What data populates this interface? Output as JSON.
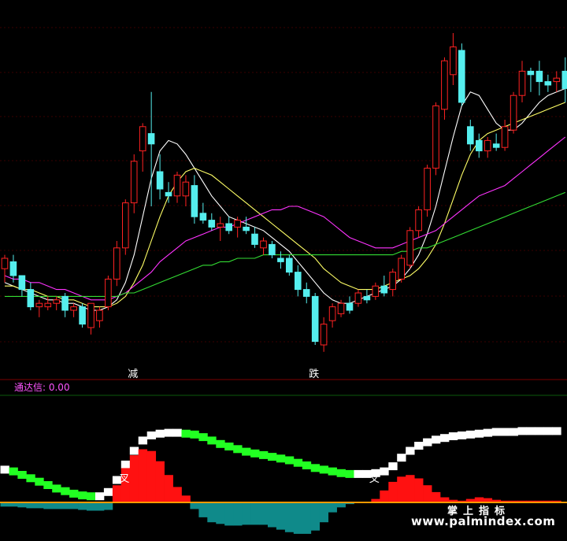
{
  "chart_data": [
    {
      "type": "candlestick",
      "title": "",
      "price_range": [
        0,
        100
      ],
      "candles": [
        {
          "o": 52,
          "h": 56,
          "l": 48,
          "c": 55
        },
        {
          "o": 54,
          "h": 56,
          "l": 48,
          "c": 50
        },
        {
          "o": 50,
          "h": 50,
          "l": 44,
          "c": 46
        },
        {
          "o": 46,
          "h": 48,
          "l": 40,
          "c": 41
        },
        {
          "o": 41,
          "h": 43,
          "l": 38,
          "c": 42
        },
        {
          "o": 41,
          "h": 44,
          "l": 40,
          "c": 42
        },
        {
          "o": 42,
          "h": 44,
          "l": 40,
          "c": 43
        },
        {
          "o": 44,
          "h": 45,
          "l": 38,
          "c": 40
        },
        {
          "o": 40,
          "h": 42,
          "l": 38,
          "c": 41
        },
        {
          "o": 41,
          "h": 42,
          "l": 35,
          "c": 36
        },
        {
          "o": 35,
          "h": 42,
          "l": 33,
          "c": 42
        },
        {
          "o": 37,
          "h": 41,
          "l": 35,
          "c": 40
        },
        {
          "o": 41,
          "h": 50,
          "l": 40,
          "c": 49
        },
        {
          "o": 49,
          "h": 60,
          "l": 47,
          "c": 58
        },
        {
          "o": 58,
          "h": 72,
          "l": 56,
          "c": 71
        },
        {
          "o": 71,
          "h": 85,
          "l": 68,
          "c": 83
        },
        {
          "o": 86,
          "h": 94,
          "l": 80,
          "c": 93
        },
        {
          "o": 91,
          "h": 103,
          "l": 70,
          "c": 88
        },
        {
          "o": 80,
          "h": 85,
          "l": 72,
          "c": 75
        },
        {
          "o": 74,
          "h": 77,
          "l": 71,
          "c": 73
        },
        {
          "o": 73,
          "h": 80,
          "l": 71,
          "c": 79
        },
        {
          "o": 73,
          "h": 79,
          "l": 70,
          "c": 77
        },
        {
          "o": 76,
          "h": 79,
          "l": 65,
          "c": 67
        },
        {
          "o": 68,
          "h": 71,
          "l": 65,
          "c": 66
        },
        {
          "o": 66,
          "h": 68,
          "l": 63,
          "c": 64
        },
        {
          "o": 64,
          "h": 67,
          "l": 60,
          "c": 65
        },
        {
          "o": 65,
          "h": 67,
          "l": 62,
          "c": 63
        },
        {
          "o": 64,
          "h": 67,
          "l": 61,
          "c": 66
        },
        {
          "o": 64,
          "h": 67,
          "l": 62,
          "c": 63
        },
        {
          "o": 62,
          "h": 64,
          "l": 58,
          "c": 59
        },
        {
          "o": 58,
          "h": 61,
          "l": 56,
          "c": 60
        },
        {
          "o": 59,
          "h": 60,
          "l": 55,
          "c": 56
        },
        {
          "o": 55,
          "h": 57,
          "l": 52,
          "c": 54
        },
        {
          "o": 55,
          "h": 56,
          "l": 50,
          "c": 51
        },
        {
          "o": 51,
          "h": 53,
          "l": 44,
          "c": 46
        },
        {
          "o": 46,
          "h": 48,
          "l": 42,
          "c": 44
        },
        {
          "o": 44,
          "h": 45,
          "l": 30,
          "c": 31
        },
        {
          "o": 30,
          "h": 38,
          "l": 28,
          "c": 36
        },
        {
          "o": 37,
          "h": 42,
          "l": 35,
          "c": 41
        },
        {
          "o": 39,
          "h": 43,
          "l": 38,
          "c": 42
        },
        {
          "o": 42,
          "h": 44,
          "l": 39,
          "c": 40
        },
        {
          "o": 42,
          "h": 46,
          "l": 41,
          "c": 45
        },
        {
          "o": 44,
          "h": 46,
          "l": 42,
          "c": 43
        },
        {
          "o": 44,
          "h": 48,
          "l": 43,
          "c": 47
        },
        {
          "o": 47,
          "h": 50,
          "l": 44,
          "c": 45
        },
        {
          "o": 46,
          "h": 52,
          "l": 44,
          "c": 51
        },
        {
          "o": 49,
          "h": 56,
          "l": 48,
          "c": 55
        },
        {
          "o": 53,
          "h": 64,
          "l": 52,
          "c": 63
        },
        {
          "o": 63,
          "h": 70,
          "l": 61,
          "c": 69
        },
        {
          "o": 69,
          "h": 82,
          "l": 67,
          "c": 81
        },
        {
          "o": 81,
          "h": 100,
          "l": 79,
          "c": 99
        },
        {
          "o": 98,
          "h": 113,
          "l": 95,
          "c": 112
        },
        {
          "o": 108,
          "h": 120,
          "l": 105,
          "c": 116
        },
        {
          "o": 115,
          "h": 117,
          "l": 99,
          "c": 100
        },
        {
          "o": 93,
          "h": 95,
          "l": 86,
          "c": 88
        },
        {
          "o": 89,
          "h": 91,
          "l": 84,
          "c": 86
        },
        {
          "o": 86,
          "h": 90,
          "l": 84,
          "c": 89
        },
        {
          "o": 88,
          "h": 91,
          "l": 86,
          "c": 87
        },
        {
          "o": 87,
          "h": 95,
          "l": 86,
          "c": 93
        },
        {
          "o": 92,
          "h": 103,
          "l": 91,
          "c": 102
        },
        {
          "o": 102,
          "h": 112,
          "l": 100,
          "c": 109
        },
        {
          "o": 109,
          "h": 110,
          "l": 103,
          "c": 108
        },
        {
          "o": 109,
          "h": 112,
          "l": 102,
          "c": 106
        },
        {
          "o": 106,
          "h": 108,
          "l": 103,
          "c": 105
        },
        {
          "o": 106,
          "h": 109,
          "l": 103,
          "c": 107
        },
        {
          "o": 109,
          "h": 113,
          "l": 100,
          "c": 104
        }
      ],
      "moving_averages": [
        {
          "label": "MA-white",
          "color": "#ffffff",
          "values": [
            48,
            47,
            46,
            45,
            44,
            43,
            43,
            42,
            42,
            41,
            40,
            40,
            41,
            43,
            48,
            56,
            67,
            78,
            86,
            89,
            88,
            85,
            81,
            77,
            73,
            70,
            67,
            66,
            65,
            64,
            63,
            61,
            59,
            57,
            54,
            51,
            48,
            45,
            43,
            42,
            42,
            43,
            44,
            45,
            46,
            47,
            49,
            52,
            56,
            62,
            70,
            80,
            90,
            99,
            103,
            102,
            98,
            94,
            92,
            92,
            94,
            97,
            100,
            102,
            103,
            104
          ]
        },
        {
          "label": "MA-yellow",
          "color": "#ffff66",
          "values": [
            47,
            47,
            46,
            46,
            45,
            44,
            44,
            43,
            43,
            42,
            41,
            41,
            41,
            42,
            44,
            48,
            53,
            60,
            67,
            73,
            77,
            80,
            81,
            80,
            79,
            77,
            75,
            73,
            71,
            69,
            67,
            65,
            63,
            61,
            59,
            57,
            55,
            52,
            50,
            48,
            47,
            46,
            46,
            46,
            47,
            48,
            49,
            50,
            52,
            55,
            59,
            65,
            72,
            79,
            85,
            89,
            91,
            92,
            93,
            94,
            95,
            96,
            97,
            98,
            99,
            100
          ]
        },
        {
          "label": "MA-magenta",
          "color": "#ff33ff",
          "values": [
            50,
            49,
            49,
            48,
            48,
            47,
            46,
            46,
            45,
            44,
            43,
            43,
            43,
            44,
            45,
            47,
            49,
            51,
            54,
            56,
            58,
            60,
            61,
            62,
            63,
            64,
            64,
            65,
            66,
            67,
            68,
            69,
            69,
            70,
            70,
            69,
            68,
            67,
            65,
            63,
            61,
            60,
            59,
            58,
            58,
            58,
            59,
            60,
            61,
            62,
            63,
            65,
            67,
            69,
            71,
            73,
            74,
            75,
            76,
            78,
            80,
            82,
            84,
            86,
            88,
            90
          ]
        },
        {
          "label": "MA-green",
          "color": "#33dd33",
          "values": [
            44,
            44,
            44,
            44,
            44,
            44,
            44,
            44,
            44,
            44,
            44,
            44,
            44,
            44,
            45,
            45,
            46,
            47,
            48,
            49,
            50,
            51,
            52,
            53,
            53,
            54,
            54,
            55,
            55,
            55,
            56,
            56,
            56,
            56,
            56,
            56,
            56,
            56,
            56,
            56,
            56,
            56,
            56,
            56,
            56,
            56,
            57,
            57,
            58,
            58,
            59,
            60,
            61,
            62,
            63,
            64,
            65,
            66,
            67,
            68,
            69,
            70,
            71,
            72,
            73,
            74
          ]
        }
      ],
      "signals": [
        {
          "index": 14,
          "label": "减",
          "color": "#ffffff"
        },
        {
          "index": 35,
          "label": "跌",
          "color": "#ffffff"
        }
      ]
    },
    {
      "type": "bar",
      "title": "",
      "indicator_name": "通达信",
      "indicator_value": "0.00",
      "readout": "通达信: 0.00",
      "values": [
        -5,
        -5,
        -6,
        -7,
        -7,
        -8,
        -8,
        -8,
        -8,
        -9,
        -10,
        -10,
        -9,
        20,
        40,
        55,
        62,
        60,
        48,
        32,
        18,
        8,
        -8,
        -18,
        -24,
        -26,
        -28,
        -28,
        -27,
        -27,
        -27,
        -30,
        -33,
        -36,
        -38,
        -38,
        -34,
        -24,
        -12,
        -6,
        -2,
        -1,
        0,
        4,
        14,
        24,
        30,
        32,
        28,
        20,
        12,
        6,
        3,
        2,
        4,
        6,
        5,
        3,
        2,
        2,
        2,
        2,
        2,
        2,
        2
      ],
      "band_values": [
        40,
        38,
        34,
        30,
        26,
        22,
        18,
        15,
        12,
        10,
        9,
        9,
        14,
        28,
        46,
        62,
        74,
        80,
        82,
        83,
        83,
        82,
        81,
        78,
        74,
        70,
        67,
        64,
        61,
        59,
        57,
        55,
        53,
        51,
        48,
        45,
        42,
        40,
        38,
        36,
        35,
        35,
        35,
        36,
        38,
        44,
        54,
        62,
        68,
        72,
        75,
        77,
        79,
        80,
        81,
        82,
        83,
        84,
        84,
        84,
        85,
        85,
        85,
        85,
        85
      ],
      "annotations": [
        {
          "index": 13,
          "label": "叉"
        },
        {
          "index": 42,
          "label": "叉"
        }
      ],
      "value_range": [
        -40,
        90
      ]
    }
  ],
  "watermark": {
    "site": "www.palmindex.com",
    "brand": "掌上指标"
  },
  "colors": {
    "up": "#ff2222",
    "down": "#55eeee",
    "grid": "#3a0000",
    "hist_pos": "#ff1111",
    "hist_neg": "#0f8a8a",
    "band_green": "#22ff22",
    "band_white": "#ffffff",
    "zero_line": "#ff9900"
  }
}
